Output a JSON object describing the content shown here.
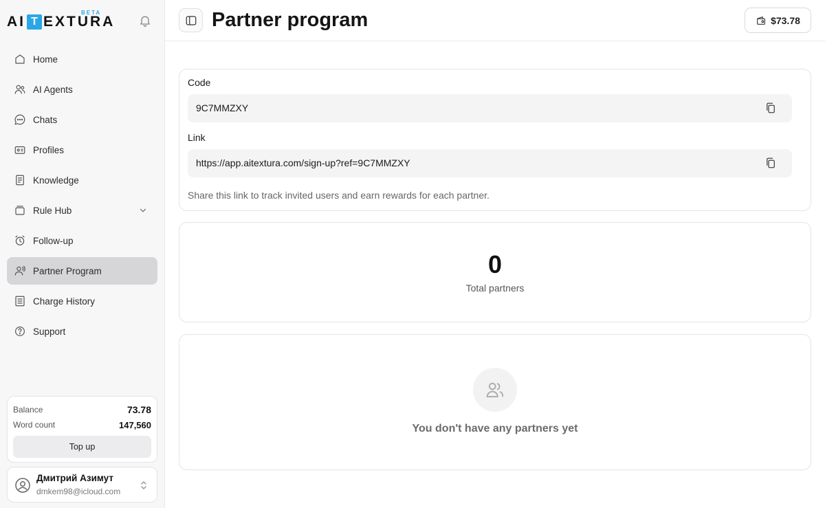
{
  "brand": {
    "name_left": "AI",
    "name_box": "T",
    "name_right": "EXTURA",
    "badge": "BETA",
    "badge_color": "#2aa7e6"
  },
  "sidebar": {
    "items": [
      {
        "label": "Home",
        "icon": "home-icon"
      },
      {
        "label": "AI Agents",
        "icon": "users-icon"
      },
      {
        "label": "Chats",
        "icon": "chat-icon"
      },
      {
        "label": "Profiles",
        "icon": "id-card-icon"
      },
      {
        "label": "Knowledge",
        "icon": "book-icon"
      },
      {
        "label": "Rule Hub",
        "icon": "stack-icon",
        "expandable": true
      },
      {
        "label": "Follow-up",
        "icon": "alarm-clock-icon"
      },
      {
        "label": "Partner Program",
        "icon": "partner-icon",
        "active": true
      },
      {
        "label": "Charge History",
        "icon": "receipt-icon"
      },
      {
        "label": "Support",
        "icon": "help-icon"
      }
    ],
    "balance": {
      "balance_label": "Balance",
      "balance_value": "73.78",
      "words_label": "Word count",
      "words_value": "147,560",
      "topup_label": "Top up"
    },
    "user": {
      "name": "Дмитрий Азимут",
      "email": "dmkem98@icloud.com"
    }
  },
  "header": {
    "title": "Partner program",
    "wallet_amount": "$73.78"
  },
  "referral": {
    "code_label": "Code",
    "code_value": "9C7MMZXY",
    "link_label": "Link",
    "link_value": "https://app.aitextura.com/sign-up?ref=9C7MMZXY",
    "hint": "Share this link to track invited users and earn rewards for each partner."
  },
  "stats": {
    "total_partners_value": "0",
    "total_partners_label": "Total partners"
  },
  "empty_state": {
    "message": "You don't have any partners yet"
  },
  "colors": {
    "active_nav_bg": "#d6d6d9",
    "field_bg": "#f4f4f5"
  }
}
